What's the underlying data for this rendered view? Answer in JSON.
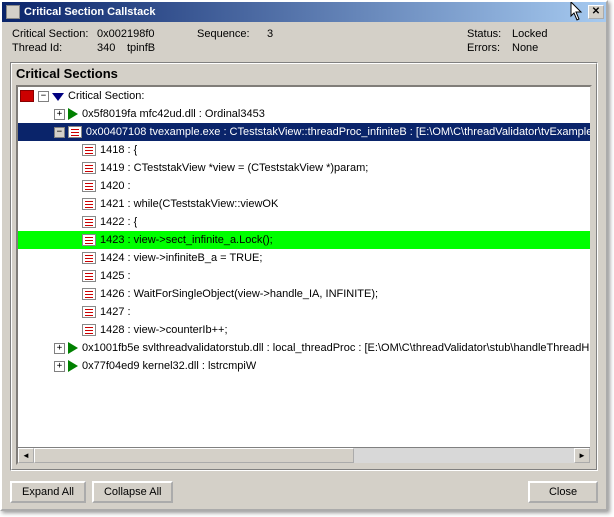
{
  "title": "Critical Section Callstack",
  "info": {
    "critical_section_label": "Critical Section:",
    "critical_section_value": "0x002198f0",
    "sequence_label": "Sequence:",
    "sequence_value": "3",
    "status_label": "Status:",
    "status_value": "Locked",
    "thread_id_label": "Thread Id:",
    "thread_id_value": "340",
    "thread_name": "tpinfB",
    "errors_label": "Errors:",
    "errors_value": "None"
  },
  "group_title": "Critical Sections",
  "tree": {
    "root_label": "Critical Section:",
    "row1": "0x5f8019fa mfc42ud.dll : Ordinal3453",
    "row2": "0x00407108 tvexample.exe : CTeststakView::threadProc_infiniteB : [E:\\OM\\C\\threadValidator\\tvExample",
    "row3": "1418 :  {",
    "row4": "1419 :     CTeststakView   *view = (CTeststakView *)param;",
    "row5": "1420 :",
    "row6": "1421 :     while(CTeststakView::viewOK",
    "row7": "1422 :     {",
    "row8": "1423 :         view->sect_infinite_a.Lock();",
    "row9": "1424 :         view->infiniteB_a = TRUE;",
    "row10": "1425 :",
    "row11": "1426 :         WaitForSingleObject(view->handle_IA, INFINITE);",
    "row12": "1427 :",
    "row13": "1428 :         view->counterIb++;",
    "row14": "0x1001fb5e svlthreadvalidatorstub.dll : local_threadProc : [E:\\OM\\C\\threadValidator\\stub\\handleThreadH",
    "row15": "0x77f04ed9 kernel32.dll : lstrcmpiW"
  },
  "buttons": {
    "expand_all": "Expand All",
    "collapse_all": "Collapse All",
    "close": "Close"
  }
}
